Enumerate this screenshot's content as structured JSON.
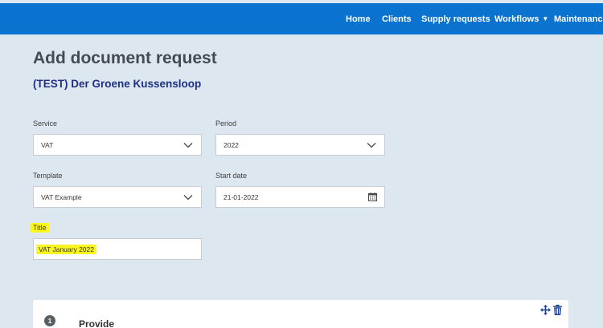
{
  "nav": {
    "home": "Home",
    "clients": "Clients",
    "supply_requests": "Supply requests",
    "workflows": "Workflows",
    "maintenance": "Maintenance"
  },
  "page": {
    "title": "Add document request",
    "client": "(TEST) Der Groene Kussensloop"
  },
  "form": {
    "service": {
      "label": "Service",
      "value": "VAT"
    },
    "period": {
      "label": "Period",
      "value": "2022"
    },
    "template": {
      "label": "Template",
      "value": "VAT Example"
    },
    "start_date": {
      "label": "Start date",
      "value": "21-01-2022"
    },
    "title": {
      "label": "Title",
      "value": "VAT January 2022"
    }
  },
  "step": {
    "number": "1",
    "label": "Provide"
  },
  "colors": {
    "nav_bg": "#0a73cf",
    "page_bg": "#dde7ef",
    "client_name": "#1f2f85",
    "highlight": "#fbf61e",
    "icon": "#1f3f8f"
  },
  "icons": [
    "chevron-down-icon",
    "calendar-icon",
    "move-icon",
    "trash-icon"
  ]
}
